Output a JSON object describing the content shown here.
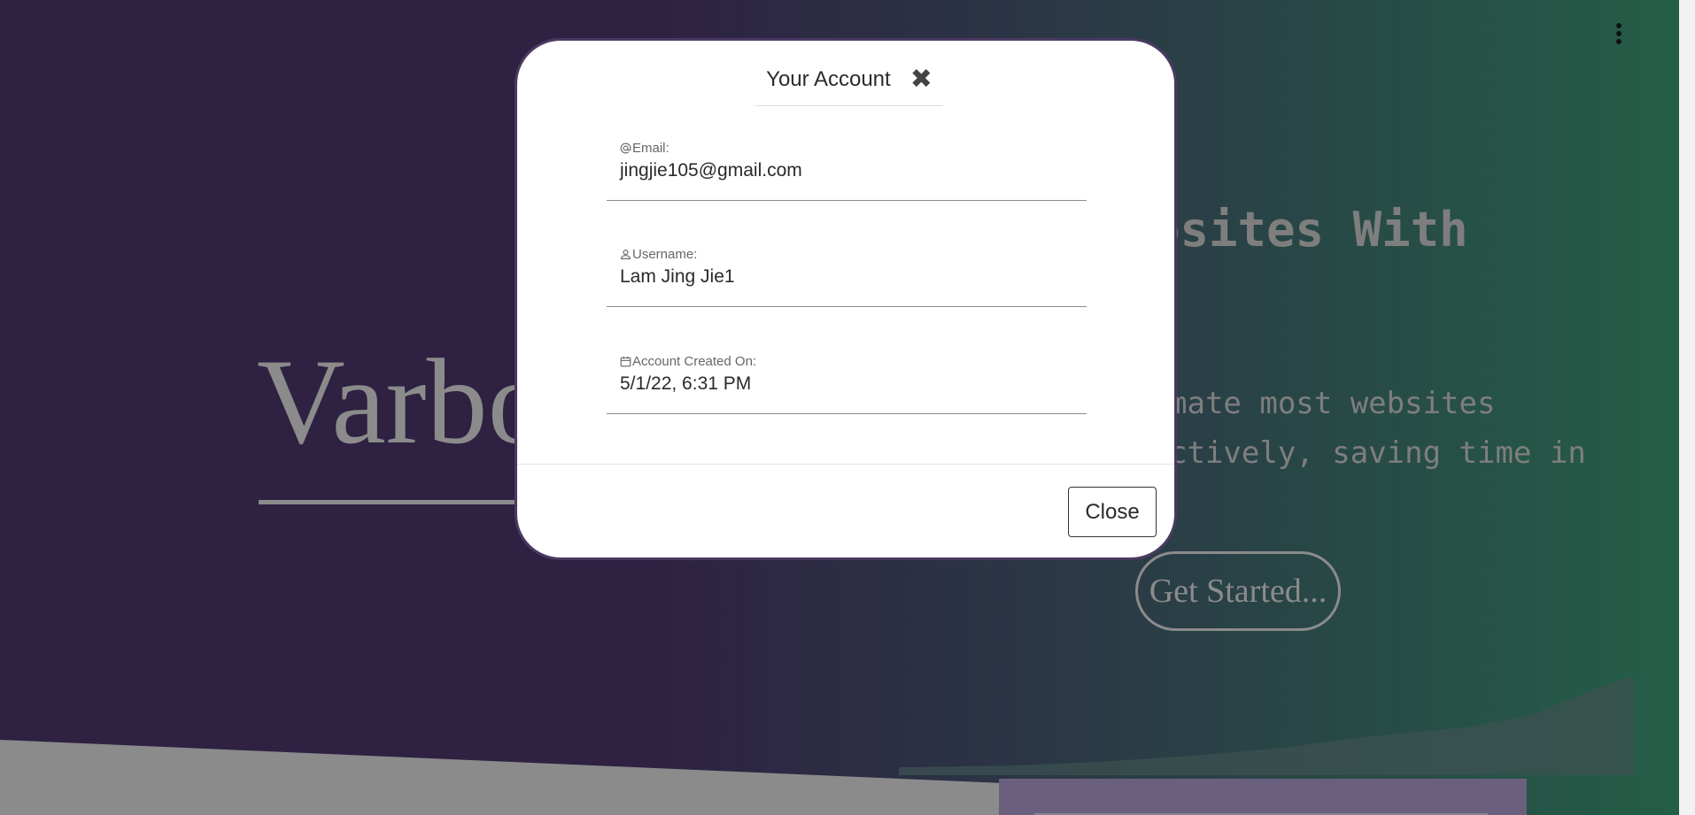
{
  "page": {
    "brand_text": "Varbo",
    "headline_text": "osites With",
    "description_text": "mate most websites\nctively, saving time in",
    "get_started_label": "Get Started...",
    "menu_icon": "more-vertical-icon"
  },
  "modal": {
    "title": "Your Account",
    "close_icon": "close-icon",
    "fields": [
      {
        "icon": "at-sign-icon",
        "label": "Email:",
        "value": "jingjie105@gmail.com"
      },
      {
        "icon": "user-icon",
        "label": "Username:",
        "value": "Lam Jing Jie1"
      },
      {
        "icon": "calendar-icon",
        "label": "Account Created On:",
        "value": "5/1/22, 6:31 PM"
      }
    ],
    "close_button_label": "Close"
  },
  "colors": {
    "bg_left": "#2e2142",
    "bg_right": "#245f47",
    "modal_border": "#4a3a63",
    "muted_text": "#8b8b8b"
  }
}
